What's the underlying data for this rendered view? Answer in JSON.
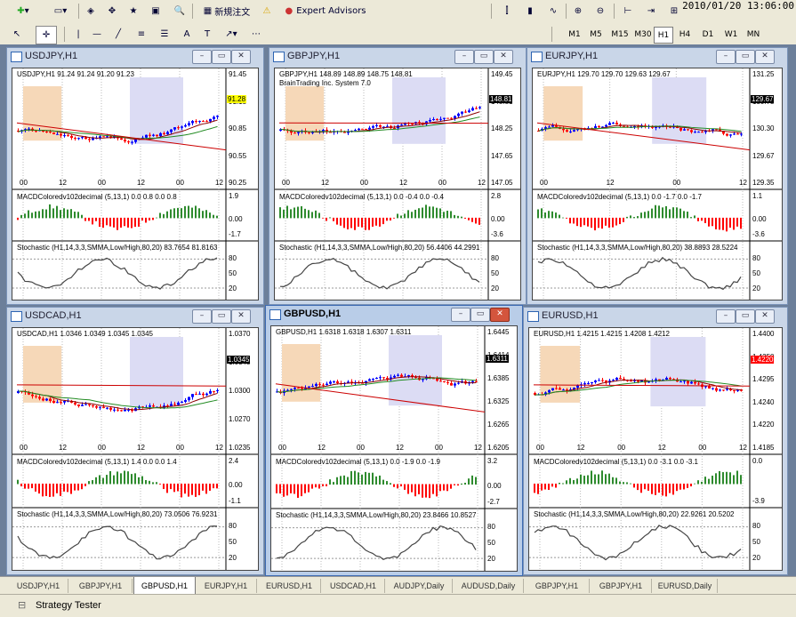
{
  "toolbar": {
    "new_order_label": "新規注文",
    "expert_advisors_label": "Expert Advisors",
    "clock": "2010/01/20 13:06:00"
  },
  "timeframes": [
    "M1",
    "M5",
    "M15",
    "M30",
    "H1",
    "H4",
    "D1",
    "W1",
    "MN"
  ],
  "active_timeframe": "H1",
  "windows": [
    {
      "title": "USDJPY,H1",
      "info": "USDJPY,H1  91.24 91.24 91.20 91.23",
      "sub": "",
      "yticks": [
        "91.45",
        "91.15",
        "90.85",
        "90.55",
        "90.25"
      ],
      "price": "91.28",
      "price2": "91.15",
      "price_color": "#ffff00",
      "xticks": [
        "00",
        "12",
        "00",
        "12",
        "00",
        "12"
      ],
      "macd": "MACDColoredv102decimal (5,13,1) 0.0 0.8 0.0 0.8",
      "macd_ticks": [
        "1.9",
        "0.00",
        "-1.7"
      ],
      "stoch": "Stochastic (H1,14,3,3,SMMA,Low/High,80,20) 83.7654 81.8163",
      "stoch_ticks": [
        "80",
        "50",
        "20"
      ],
      "active": false,
      "trend": "up"
    },
    {
      "title": "GBPJPY,H1",
      "info": "GBPJPY,H1  148.89 148.89 148.75 148.81",
      "sub": "BrainTrading Inc. System 7.0",
      "yticks": [
        "149.45",
        "148.81",
        "148.25",
        "147.65",
        "147.05"
      ],
      "price": "148.81",
      "price2": "",
      "price_color": "#000000",
      "xticks": [
        "00",
        "12",
        "00",
        "12",
        "00",
        "12"
      ],
      "macd": "MACDColoredv102decimal (5,13,1) 0.0 -0.4 0.0 -0.4",
      "macd_ticks": [
        "2.8",
        "0.00",
        "-3.6"
      ],
      "stoch": "Stochastic (H1,14,3,3,SMMA,Low/High,80,20) 56.4406 44.2991",
      "stoch_ticks": [
        "80",
        "50",
        "20"
      ],
      "active": false,
      "trend": "up"
    },
    {
      "title": "EURJPY,H1",
      "info": "EURJPY,H1  129.70 129.70 129.63 129.67",
      "sub": "",
      "yticks": [
        "131.25",
        "130.75",
        "130.30",
        "129.67",
        "129.35"
      ],
      "price": "129.67",
      "price2": "",
      "price_color": "#000000",
      "xticks": [
        "00",
        "12",
        "00",
        "12"
      ],
      "macd": "MACDColoredv102decimal (5,13,1) 0.0 -1.7 0.0 -1.7",
      "macd_ticks": [
        "1.1",
        "0.00",
        "-3.6"
      ],
      "stoch": "Stochastic (H1,14,3,3,SMMA,Low/High,80,20) 38.8893 28.5224",
      "stoch_ticks": [
        "80",
        "50",
        "20"
      ],
      "active": false,
      "trend": "down"
    },
    {
      "title": "USDCAD,H1",
      "info": "USDCAD,H1  1.0346 1.0349 1.0345 1.0345",
      "sub": "",
      "yticks": [
        "1.0370",
        "1.0345",
        "1.0300",
        "1.0270",
        "1.0235"
      ],
      "price": "1.0345",
      "price2": "1.0350",
      "price_color": "#000000",
      "xticks": [
        "00",
        "12",
        "00",
        "12",
        "00",
        "12"
      ],
      "macd": "MACDColoredv102decimal (5,13,1) 1.4 0.0 0.0 1.4",
      "macd_ticks": [
        "2.4",
        "0.00",
        "-1.1"
      ],
      "stoch": "Stochastic (H1,14,3,3,SMMA,Low/High,80,20) 73.0506 76.9231",
      "stoch_ticks": [
        "80",
        "50",
        "20"
      ],
      "active": false,
      "trend": "up"
    },
    {
      "title": "GBPUSD,H1",
      "info": "GBPUSD,H1  1.6318 1.6318 1.6307 1.6311",
      "sub": "",
      "yticks": [
        "1.6445",
        "1.6414",
        "1.6385",
        "1.6325",
        "1.6265",
        "1.6205"
      ],
      "price": "1.6311",
      "price2": "1.6414",
      "price_color": "#000000",
      "xticks": [
        "00",
        "12",
        "00",
        "12",
        "00",
        "12"
      ],
      "macd": "MACDColoredv102decimal (5,13,1) 0.0 -1.9 0.0 -1.9",
      "macd_ticks": [
        "3.2",
        "0.00",
        "-2.7"
      ],
      "stoch": "Stochastic (H1,14,3,3,SMMA,Low/High,80,20) 23.8466 10.8527",
      "stoch_ticks": [
        "80",
        "50",
        "20"
      ],
      "active": true,
      "trend": "updown"
    },
    {
      "title": "EURUSD,H1",
      "info": "EURUSD,H1  1.4215 1.4215 1.4208 1.4212",
      "sub": "",
      "yticks": [
        "1.4400",
        "1.4350",
        "1.4295",
        "1.4240",
        "1.4220",
        "1.4185"
      ],
      "price": "1.4220",
      "price2": "",
      "price_color": "#ffffff",
      "xticks": [
        "00",
        "12",
        "00",
        "12",
        "00",
        "12"
      ],
      "macd": "MACDColoredv102decimal (5,13,1) 0.0 -3.1 0.0 -3.1",
      "macd_ticks": [
        "0.0",
        "",
        "-3.9"
      ],
      "stoch": "Stochastic (H1,14,3,3,SMMA,Low/High,80,20) 22.9261 20.5202",
      "stoch_ticks": [
        "80",
        "50",
        "20"
      ],
      "active": false,
      "trend": "down"
    }
  ],
  "tabs": [
    "USDJPY,H1",
    "GBPJPY,H1",
    "GBPUSD,H1",
    "EURJPY,H1",
    "EURUSD,H1",
    "USDCAD,H1",
    "AUDJPY,Daily",
    "AUDUSD,Daily",
    "GBPJPY,H1",
    "GBPJPY,H1",
    "EURUSD,Daily"
  ],
  "active_tab": 2,
  "status": {
    "strategy_tester": "Strategy Tester"
  },
  "colors": {
    "bull": "#0000ff",
    "bear": "#ff0000",
    "macd_up": "#2e8b2e",
    "macd_down": "#ff0000",
    "stoch": "#000000"
  }
}
